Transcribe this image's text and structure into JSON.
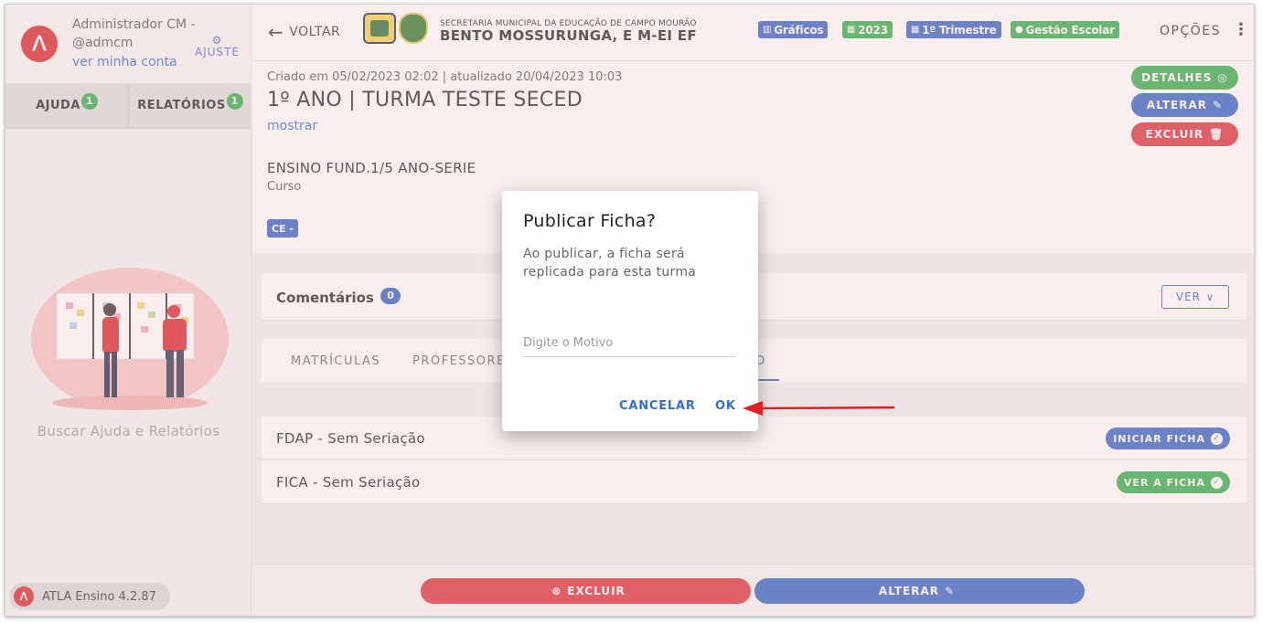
{
  "sidebar": {
    "user_name": "Administrador CM - @admcm",
    "user_link": "ver minha conta",
    "ajuste": "AJUSTE",
    "tabs": [
      {
        "label": "AJUDA",
        "badge": "1"
      },
      {
        "label": "RELATÓRIOS",
        "badge": "1"
      }
    ],
    "help_text": "Buscar Ajuda e Relatórios",
    "version": "ATLA Ensino 4.2.87"
  },
  "topbar": {
    "back_label": "VOLTAR",
    "school_sub": "SECRETARIA MUNICIPAL DA EDUCAÇÃO DE CAMPO MOURÃO",
    "school_title": "BENTO MOSSURUNGA, E M-EI EF",
    "chips": {
      "graficos": "Gráficos",
      "year": "2023",
      "trimestre": "1º Trimestre",
      "gestao": "Gestão Escolar"
    },
    "opcoes": "OPÇÕES"
  },
  "header": {
    "created": "Criado em 05/02/2023 02:02 | atualizado 20/04/2023 10:03",
    "turma": "1º ANO | TURMA TESTE SECED",
    "mostrar": "mostrar",
    "curso_name": "ENSINO FUND.1/5 ANO-SERIE",
    "curso_label": "Curso",
    "ce_chip": "CE -",
    "buttons": {
      "detalhes": "DETALHES",
      "alterar": "ALTERAR",
      "excluir": "EXCLUIR"
    }
  },
  "comments": {
    "title": "Comentários",
    "count": "0",
    "ver": "VER"
  },
  "tabs": {
    "matriculas": "MATRÍCULAS",
    "professores": "PROFESSORE",
    "partial_active": "O"
  },
  "fichas": [
    {
      "name": "FDAP - Sem Seriação",
      "action": "INICIAR FICHA"
    },
    {
      "name": "FICA - Sem Seriação",
      "action": "VER A FICHA"
    }
  ],
  "footer": {
    "excluir": "EXCLUIR",
    "alterar": "ALTERAR"
  },
  "dialog": {
    "title": "Publicar Ficha?",
    "message": "Ao publicar, a ficha será replicada para esta turma",
    "input_placeholder": "Digite o Motivo",
    "cancel": "CANCELAR",
    "ok": "OK"
  },
  "colors": {
    "brand_red": "#d8262b",
    "primary_blue": "#2f62c8",
    "success_green": "#2cae4b",
    "danger_red": "#d8323c"
  },
  "icons": {
    "logo": "atla-logo-icon",
    "gear": "gear-icon",
    "back": "arrow-left-icon",
    "chart": "bar-chart-icon",
    "calendar": "calendar-icon",
    "check": "check-circle-icon",
    "eye_off": "eye-off-icon",
    "edit": "edit-icon",
    "trash": "trash-icon",
    "chevron": "chevron-down-icon"
  }
}
